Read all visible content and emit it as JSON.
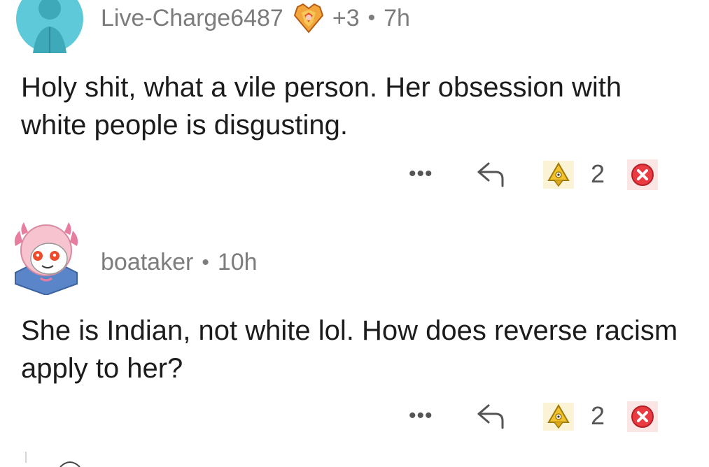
{
  "comments": [
    {
      "username": "Live-Charge6487",
      "award_count": "+3",
      "age": "7h",
      "body": "Holy shit, what a vile person. Her obsession with white people is disgusting.",
      "more_label": "•••",
      "score": "2"
    },
    {
      "username": "boataker",
      "age": "10h",
      "body": "She is Indian, not white lol. How does reverse racism apply to her?",
      "more_label": "•••",
      "score": "2"
    }
  ],
  "separator": "•",
  "colors": {
    "meta_text": "#7c7c7c",
    "body_text": "#1c1c1c",
    "avatar_teal": "#4fb8c8",
    "downvote_red": "#ea3a42",
    "award_gold": "#f2c22c"
  },
  "icons": {
    "reply": "reply-arrow-icon",
    "award": "award-icon",
    "downvote": "downvote-x-icon",
    "flair": "gem-flair-icon"
  }
}
